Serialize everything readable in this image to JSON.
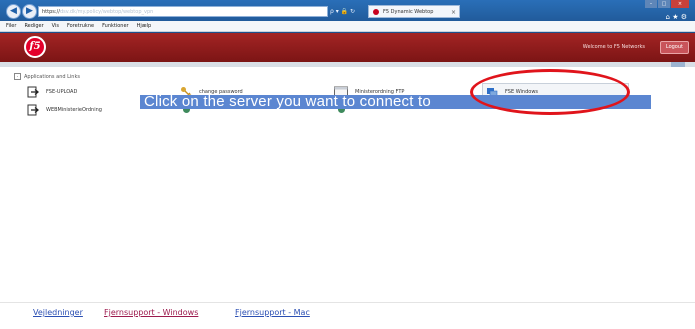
{
  "browser": {
    "address_prefix": "https://",
    "address_host": "dsv.dk",
    "address_rest": "/my.policy/webtop/webtop_vpn",
    "addr_tools": "ρ ▾ 🔒 ↻",
    "tab_title": "F5 Dynamic Webtop",
    "tab_close": "×",
    "window_controls": {
      "minimize": "–",
      "maximize": "□",
      "close": "×"
    },
    "chrome_icons": "⌂ ★ ⚙",
    "menu": [
      "Filer",
      "Rediger",
      "Vis",
      "Foretrukne",
      "Funktioner",
      "Hjælp"
    ]
  },
  "header": {
    "logo_text": "f5",
    "welcome": "Welcome to F5 Networks",
    "logout": "Logout"
  },
  "section": {
    "toggle": "-",
    "title": "Applications and Links"
  },
  "apps": [
    {
      "label": "FSE-UPLOAD",
      "icon": "document-arrow-icon"
    },
    {
      "label": "change password",
      "icon": "key-icon"
    },
    {
      "label": "Ministerordning FTP",
      "icon": "window-icon"
    },
    {
      "label": "FSE Windows",
      "icon": "remote-desktop-icon"
    },
    {
      "label": "WEBMinisterieOrdning",
      "icon": "document-arrow-icon"
    }
  ],
  "overlay_text": "Click on the server you want to connect to",
  "colors": {
    "header": "#8c1d1d",
    "highlight": "#5b86d1",
    "annotation_ring": "#e0141b",
    "footer_link_1": "#2b4fb3",
    "footer_link_2": "#9c1a4d",
    "footer_link_3": "#2b4fb3"
  },
  "footer": {
    "links": [
      "Vejledninger",
      "Fjernsupport - Windows",
      "Fjernsupport - Mac"
    ]
  }
}
